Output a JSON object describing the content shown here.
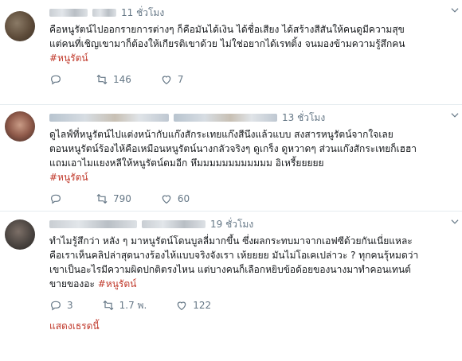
{
  "tweets": [
    {
      "time": "11 ชั่วโมง",
      "lines": [
        "คือหนูรัตน์ไปออกรายการต่างๆ ก็คือมันได้เงิน ได้ชื่อเสียง ได้สร้างสีสันให้คนดูมีความสุข",
        "แต่คนที่เชิญเขามาก็ต้องให้เกียรติเขาด้วย ไม่ใช่อยากได้เรทติ้ง จนมองข้ามความรู้สึกคน"
      ],
      "hashtag": "#หนูรัตน์",
      "stats": {
        "replies": "",
        "retweets": "146",
        "likes": "7"
      }
    },
    {
      "time": "13 ชั่วโมง",
      "lines": [
        "ดูไลฟ์ที่หนูรัตน์ไปแต่งหน้ากับแก๊งสักระเทยแก๊งสีนึงแล้วแบบ สงสารหนูรัตน์จากใจเลย",
        "ตอนหนูรัตน์ร้องไห้คือเหมือนหนูรัตน์นางกลัวจริงๆ ดูเกร็ง ดูหวาดๆ ส่วนแก๊งสักระเทยก็เฮฮา",
        "แถมเอาไมแยงหลีให้หนูรัตน์ดมอีก หึมมมมมมมมมมมม อิเหรี้ยยยยย"
      ],
      "hashtag": "#หนูรัตน์",
      "stats": {
        "replies": "",
        "retweets": "790",
        "likes": "60"
      }
    },
    {
      "time": "19 ชั่วโมง",
      "lines": [
        "ทำไมรู้สึกว่า หลัง ๆ มาหนูรัตน์โดนบูลลี่มากขึ้น ซึ่งผลกระทบมาจากเอฟซีด้วยกันเนี่ยแหละ",
        "คือเราเห็นคลิปล่าสุดนางร้องไห้แบบจริงจังเรา เห้ยยยย มันไม่โอเคเปล่าวะ ? ทุกคนรุ้หมดว่า",
        "เขาเป็นอะไรมีความผิดปกติตรงไหน แต่บางคนก็เลือกหยิบข้อด้อยของนางมาทำคอนเทนต์",
        "ขายของอะ"
      ],
      "hashtag": "#หนูรัตน์",
      "stats": {
        "replies": "3",
        "retweets": "1.7 พ.",
        "likes": "122"
      }
    }
  ],
  "show_thread_label": "แสดงเธรดนี้",
  "colors": {
    "hashtag": "#c0392b",
    "meta": "#657786",
    "text": "#14171a",
    "divider": "#e6ecf0"
  },
  "icons": [
    "reply-icon",
    "retweet-icon",
    "like-icon",
    "chevron-down-icon"
  ]
}
